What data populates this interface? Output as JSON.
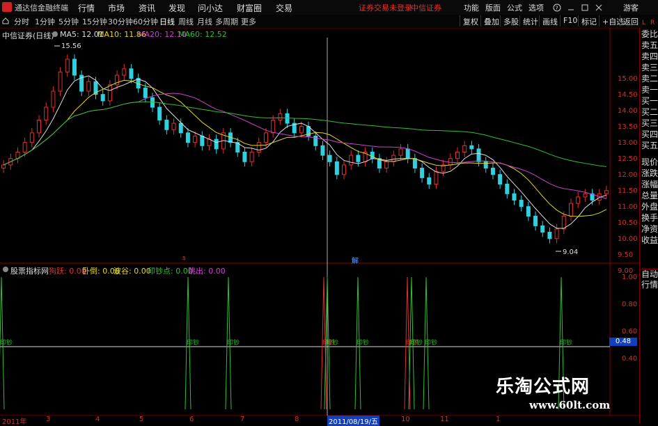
{
  "app": {
    "title": "通达信金融终端"
  },
  "menu": {
    "items": [
      "行情",
      "市场",
      "资讯",
      "发现",
      "问小达",
      "财富圈",
      "交易"
    ],
    "status": "证券交易未登录",
    "broker": "中信证券",
    "right_items": [
      "功能",
      "版面",
      "公式",
      "选项"
    ],
    "user": "游客"
  },
  "periods": [
    "分时",
    "1分钟",
    "5分钟",
    "15分钟",
    "30分钟",
    "60分钟",
    "日线",
    "周线",
    "月线",
    "多周期",
    "更多"
  ],
  "active_period": "日线",
  "tools": [
    "复权",
    "叠加",
    "多股",
    "统计",
    "画线",
    "F10",
    "标记",
    "+自选",
    "返回"
  ],
  "stock": {
    "name": "中信证券(日线)"
  },
  "ma": [
    {
      "label": "MA5: 12.01",
      "color": "#dddddd"
    },
    {
      "label": "MA10: 11.86",
      "color": "#e8d820"
    },
    {
      "label": "MA20: 12.10",
      "color": "#d040d0"
    },
    {
      "label": "MA60: 12.52",
      "color": "#30c030"
    }
  ],
  "annotations": {
    "high": "15.56",
    "low": "9.04",
    "marker_s": "s",
    "marker_jie": "解"
  },
  "price_axis": [
    "15.00",
    "14.50",
    "14.00",
    "13.50",
    "13.00",
    "12.50",
    "12.00",
    "11.50",
    "11.00",
    "10.50",
    "10.00",
    "9.50",
    "9.00"
  ],
  "indicator": {
    "name": "股票指标网",
    "fields": [
      {
        "label": "狗跃: 0.00",
        "color": "#e03030"
      },
      {
        "label": "卧倒: 0.00",
        "color": "#e8d820"
      },
      {
        "label": "波谷: 0.00",
        "color": "#e8d820"
      },
      {
        "label": "印钞点: 0.00",
        "color": "#30c030"
      },
      {
        "label": "跳出: 0.00",
        "color": "#d040d0"
      }
    ],
    "axis": [
      "1.00",
      "0.80",
      "0.60",
      "0.40"
    ],
    "current_value": "0.48",
    "spike_label": "印钞"
  },
  "dates": [
    "2011年",
    "3",
    "4",
    "5",
    "6",
    "7",
    "8",
    "2011/08/19/五",
    "10",
    "11",
    "1"
  ],
  "right_panel": [
    "委比",
    "卖五",
    "卖四",
    "卖三",
    "卖二",
    "卖一",
    "买一",
    "买二",
    "买三",
    "买四",
    "买五",
    "现价",
    "涨跌",
    "涨幅",
    "总量",
    "外盘",
    "换手",
    "净资",
    "收益",
    "自动",
    "行情"
  ],
  "panel_marks": [
    "L",
    "R"
  ],
  "watermark": {
    "title": "乐淘公式网",
    "url": "www.60lt.com"
  },
  "chart_data": {
    "type": "candlestick",
    "ylim": [
      8.9,
      15.7
    ],
    "close": [
      11.9,
      12.1,
      12.3,
      12.6,
      12.9,
      13.3,
      13.7,
      14.2,
      14.8,
      15.2,
      14.7,
      14.2,
      14.5,
      14.1,
      13.9,
      14.4,
      14.7,
      14.9,
      14.6,
      14.3,
      14.0,
      13.7,
      13.3,
      13.0,
      13.2,
      12.9,
      12.6,
      12.8,
      12.5,
      12.7,
      12.4,
      12.9,
      12.6,
      12.3,
      12.0,
      12.3,
      12.6,
      12.9,
      13.3,
      13.5,
      13.2,
      12.9,
      13.1,
      12.8,
      12.5,
      12.2,
      12.0,
      11.6,
      11.9,
      12.2,
      12.0,
      12.3,
      12.1,
      11.8,
      12.0,
      12.2,
      12.4,
      12.1,
      11.8,
      11.5,
      11.3,
      11.7,
      11.9,
      12.1,
      12.3,
      12.5,
      12.4,
      12.0,
      11.8,
      11.6,
      11.3,
      11.0,
      10.8,
      10.6,
      10.3,
      10.0,
      9.8,
      9.6,
      9.9,
      10.3,
      10.7,
      10.9,
      11.0,
      10.8,
      11.0,
      11.1
    ]
  }
}
